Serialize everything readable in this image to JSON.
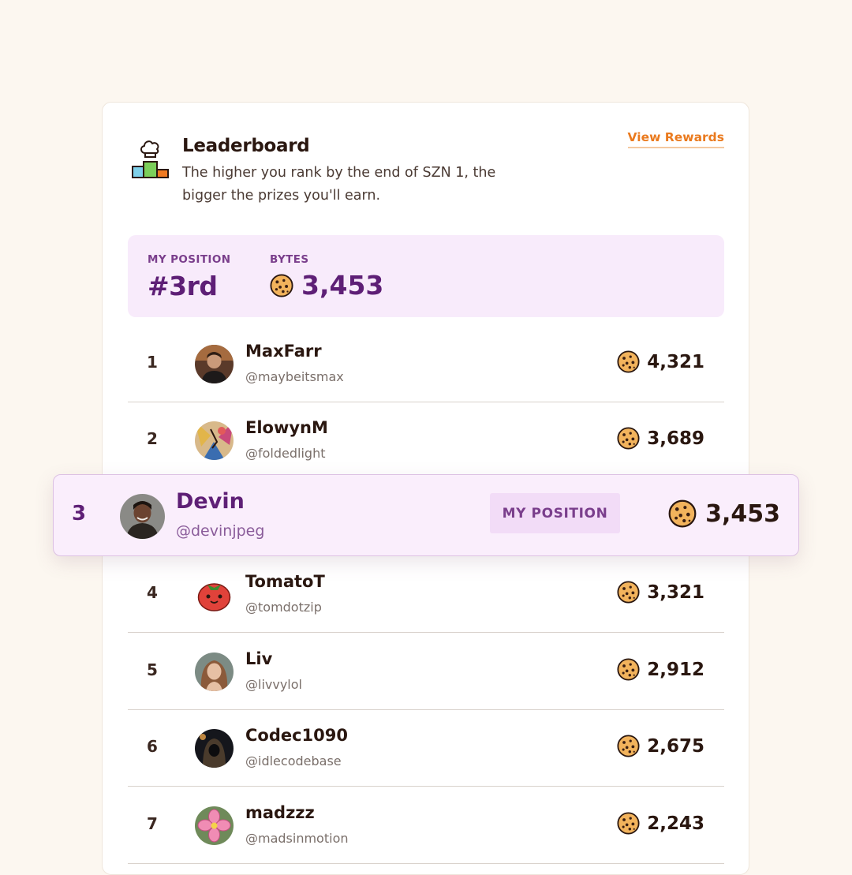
{
  "header": {
    "title": "Leaderboard",
    "subtitle": "The higher you rank by the end of SZN 1, the bigger the prizes you'll earn.",
    "view_rewards": "View Rewards",
    "icon": "podium-chef-hat-icon"
  },
  "my_position_panel": {
    "position_label": "MY POSITION",
    "position_value": "#3rd",
    "bytes_label": "BYTES",
    "bytes_value": "3,453"
  },
  "colors": {
    "accent": "#ea7a1e",
    "purple": "#5e1f76",
    "panel_bg": "#f8ebfb"
  },
  "rows": [
    {
      "rank": "1",
      "name": "MaxFarr",
      "handle": "@maybeitsmax",
      "score": "4,321"
    },
    {
      "rank": "2",
      "name": "ElowynM",
      "handle": "@foldedlight",
      "score": "3,689"
    },
    {
      "rank": "4",
      "name": "TomatoT",
      "handle": "@tomdotzip",
      "score": "3,321"
    },
    {
      "rank": "5",
      "name": "Liv",
      "handle": "@livvylol",
      "score": "2,912"
    },
    {
      "rank": "6",
      "name": "Codec1090",
      "handle": "@idlecodebase",
      "score": "2,675"
    },
    {
      "rank": "7",
      "name": "madzzz",
      "handle": "@madsinmotion",
      "score": "2,243"
    }
  ],
  "current_user": {
    "rank": "3",
    "name": "Devin",
    "handle": "@devinjpeg",
    "badge": "MY POSITION",
    "score": "3,453"
  }
}
